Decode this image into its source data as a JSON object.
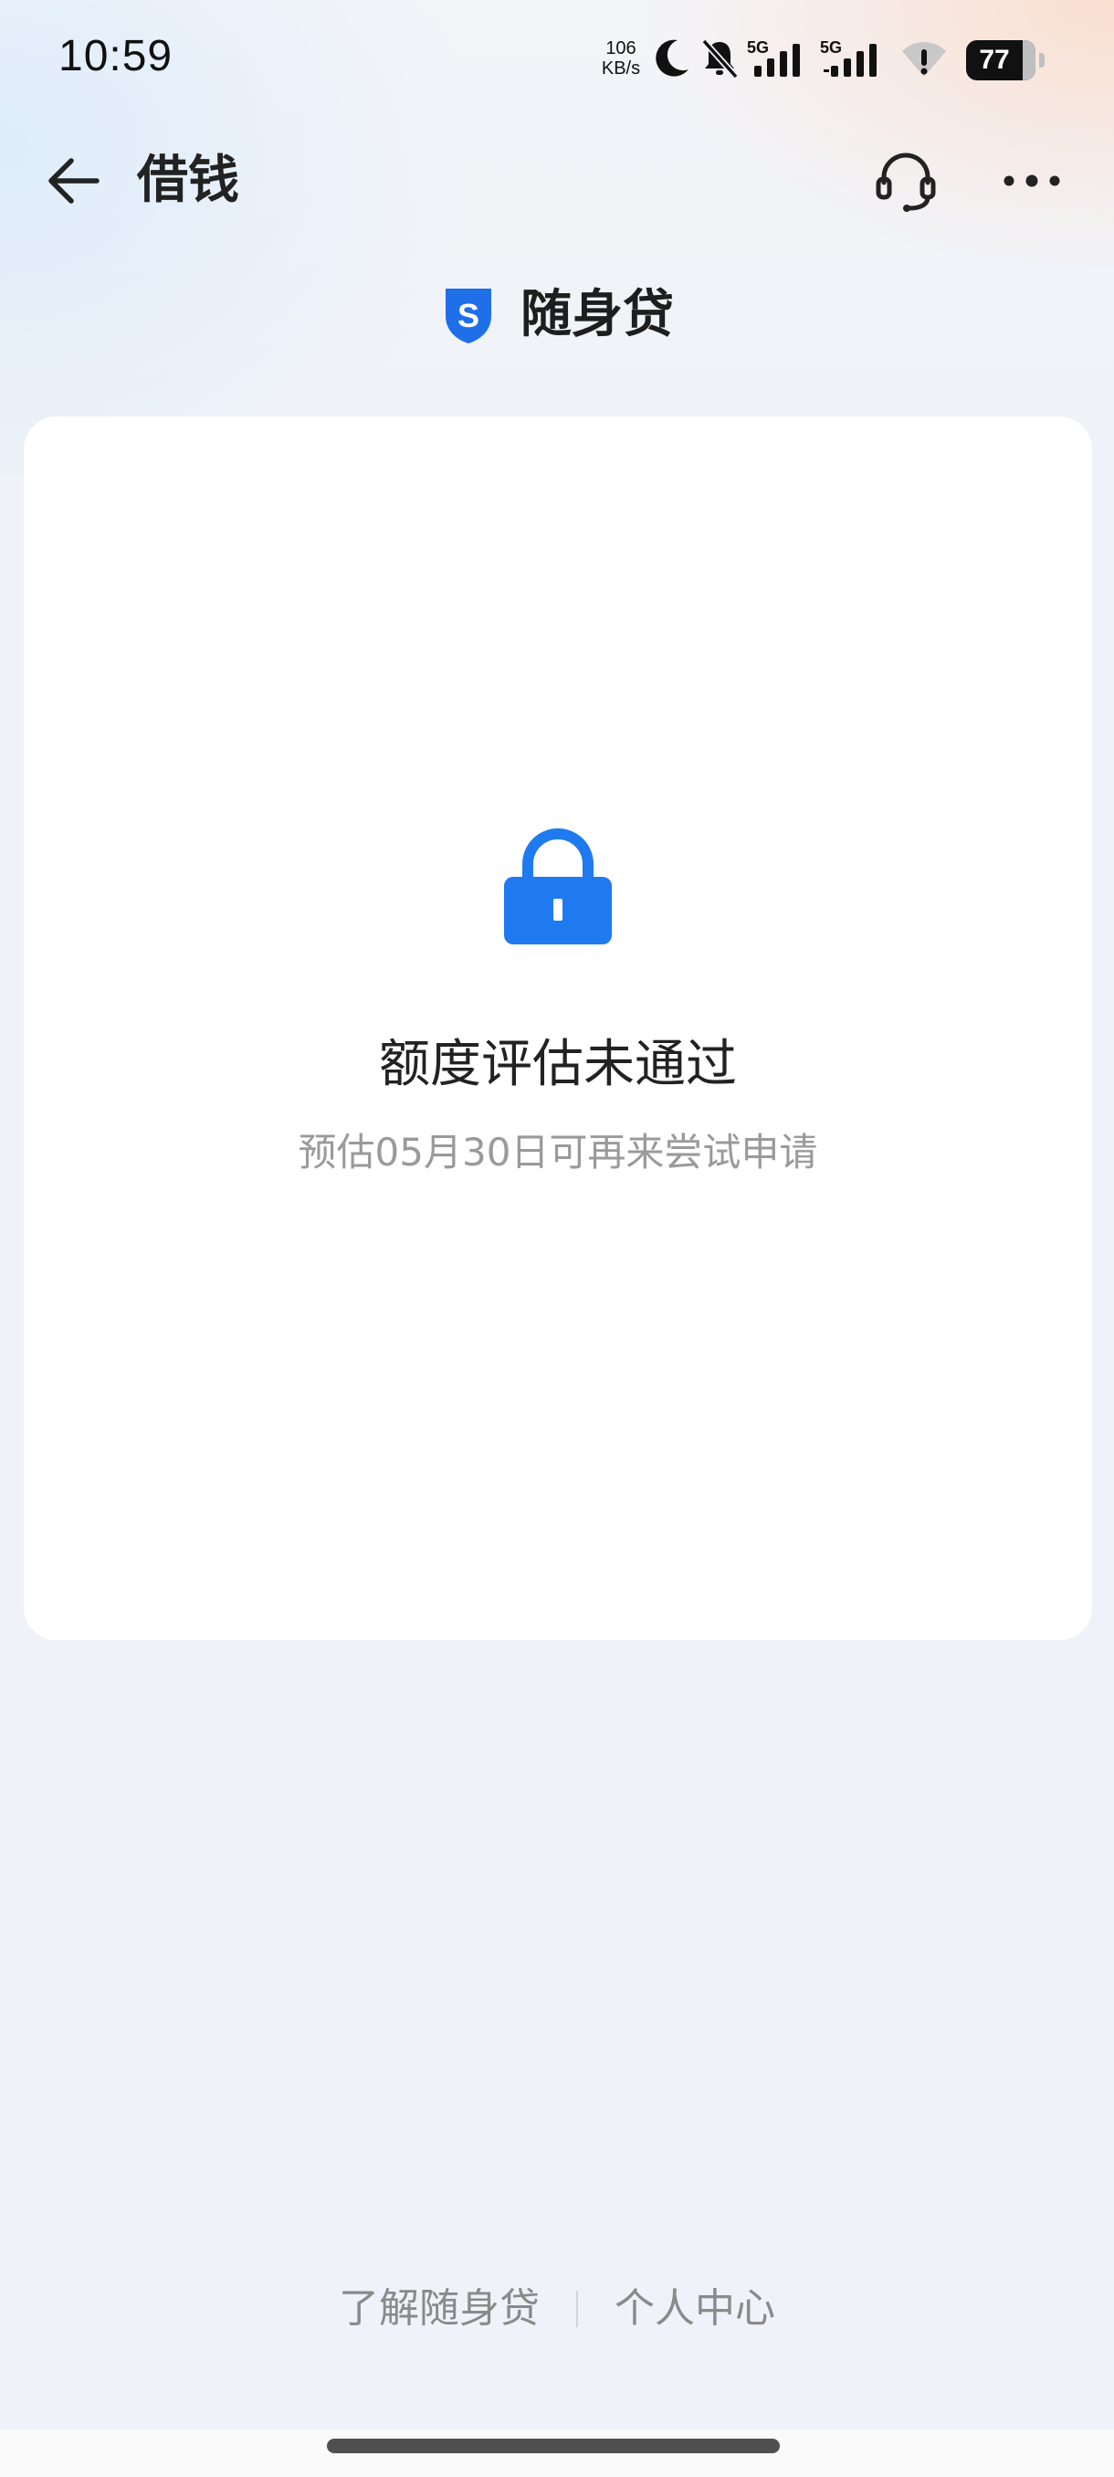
{
  "status_bar": {
    "time": "10:59",
    "speed_value": "106",
    "speed_unit": "KB/s",
    "sim1_label": "5G",
    "sim2_label": "5G",
    "battery": "77",
    "icons": [
      "moon-icon",
      "bell-off-icon",
      "signal-icon",
      "signal-icon",
      "wifi-warning-icon",
      "battery-icon"
    ]
  },
  "header": {
    "title": "借钱",
    "icons": [
      "back-arrow-icon",
      "headset-icon",
      "more-icon"
    ]
  },
  "brand": {
    "logo_letter": "S",
    "name": "随身贷",
    "color": "#1f6fe8"
  },
  "result": {
    "icon": "lock-icon",
    "title": "额度评估未通过",
    "subtitle": "预估05月30日可再来尝试申请",
    "accent": "#1f7af0"
  },
  "footer": {
    "links": [
      "了解随身贷",
      "个人中心"
    ]
  }
}
